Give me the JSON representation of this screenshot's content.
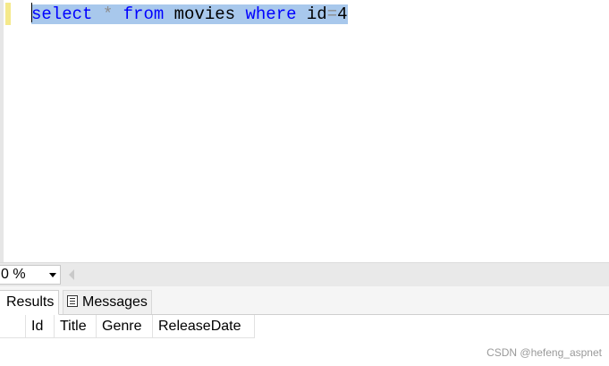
{
  "editor": {
    "query": {
      "kw_select": "select",
      "star": "*",
      "kw_from": "from",
      "table": "movies",
      "kw_where": "where",
      "column": "id",
      "eq": "=",
      "value": "4"
    }
  },
  "statusbar": {
    "zoom": "0 %"
  },
  "results_tabs": {
    "results": "Results",
    "messages": "Messages"
  },
  "grid": {
    "columns": [
      "Id",
      "Title",
      "Genre",
      "ReleaseDate"
    ]
  },
  "watermark": "CSDN @hefeng_aspnet",
  "colors": {
    "keyword": "#0000ff",
    "operator": "#8d8d8d",
    "selection": "#a8c8ec",
    "change_bar": "#f5e98b"
  }
}
